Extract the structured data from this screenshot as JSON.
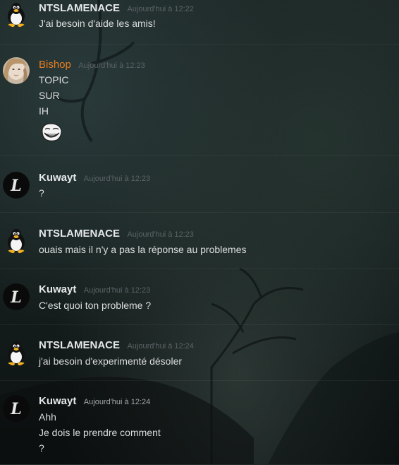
{
  "messages": [
    {
      "username": "NTSLAMENACE",
      "timestamp": "Aujourd'hui à 12:22",
      "avatar": "tux-penguin-icon",
      "lines": [
        "J'ai besoin d'aide les amis!"
      ]
    },
    {
      "username": "Bishop",
      "timestamp": "Aujourd'hui à 12:23",
      "avatar": "user-photo",
      "username_color": "#e67e22",
      "lines": [
        "TOPIC",
        "SUR",
        "IH"
      ],
      "emoji": "trollface-emoji-icon"
    },
    {
      "username": "Kuwayt",
      "timestamp": "Aujourd'hui à 12:23",
      "avatar": "death-note-l-icon",
      "lines": [
        "?"
      ]
    },
    {
      "username": "NTSLAMENACE",
      "timestamp": "Aujourd'hui à 12:23",
      "avatar": "tux-penguin-icon",
      "lines": [
        "ouais mais il n'y a pas la réponse au problemes"
      ]
    },
    {
      "username": "Kuwayt",
      "timestamp": "Aujourd'hui à 12:23",
      "avatar": "death-note-l-icon",
      "lines": [
        "C'est quoi ton probleme ?"
      ]
    },
    {
      "username": "NTSLAMENACE",
      "timestamp": "Aujourd'hui à 12:24",
      "avatar": "tux-penguin-icon",
      "lines": [
        "j'ai besoin d'experimenté désoler"
      ]
    },
    {
      "username": "Kuwayt",
      "timestamp": "Aujourd'hui à 12:24",
      "avatar": "death-note-l-icon",
      "lines": [
        "Ahh",
        "Je dois le prendre comment",
        "?"
      ]
    }
  ]
}
